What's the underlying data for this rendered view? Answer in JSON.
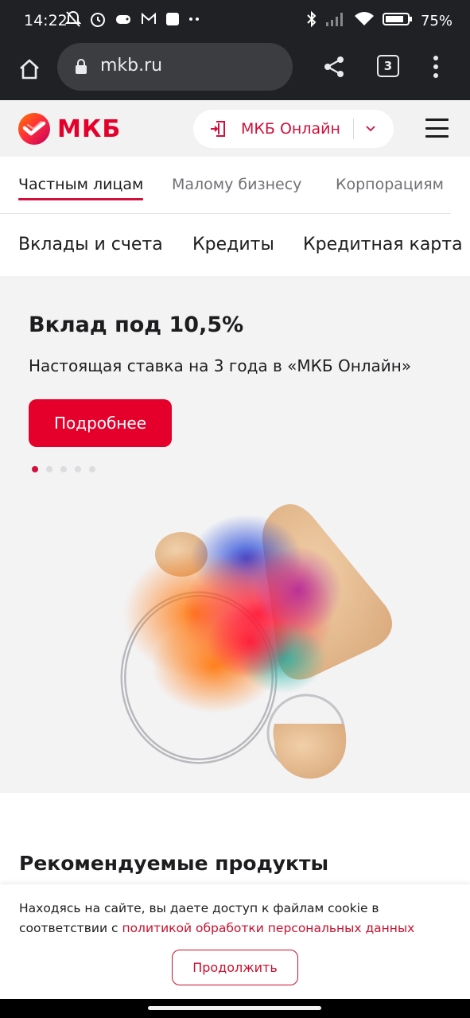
{
  "status_bar": {
    "time": "14:22",
    "battery": "75%",
    "icons_left": [
      "muted-bell-icon",
      "alarm-icon",
      "game-controller-icon",
      "mail-icon",
      "square-notification-icon",
      "more-notifications-icon"
    ],
    "icons_right": [
      "bluetooth-icon",
      "signal-icon",
      "wifi-icon",
      "battery-icon"
    ]
  },
  "browser": {
    "url": "mkb.ru",
    "tab_count": "3"
  },
  "header": {
    "logo_text": "МКБ",
    "online_button": "МКБ Онлайн",
    "colors": {
      "brand": "#e4002b",
      "link": "#c8102e"
    }
  },
  "segments": [
    {
      "label": "Частным лицам",
      "active": true
    },
    {
      "label": "Малому бизнесу",
      "active": false
    },
    {
      "label": "Корпорациям",
      "active": false
    }
  ],
  "products_nav": [
    "Вклады и счета",
    "Кредиты",
    "Кредитная карта"
  ],
  "hero": {
    "title": "Вклад под 10,5%",
    "subtitle": "Настоящая ставка на 3 года в «МКБ Онлайн»",
    "button": "Подробнее",
    "slide_count": 5,
    "active_slide": 1
  },
  "recommended": {
    "title": "Рекомендуемые продукты"
  },
  "cookie": {
    "text_before": "Находясь на сайте, вы даете доступ к файлам cookie в соответствии с",
    "link": "политикой обработки персональных данных",
    "button": "Продолжить"
  }
}
